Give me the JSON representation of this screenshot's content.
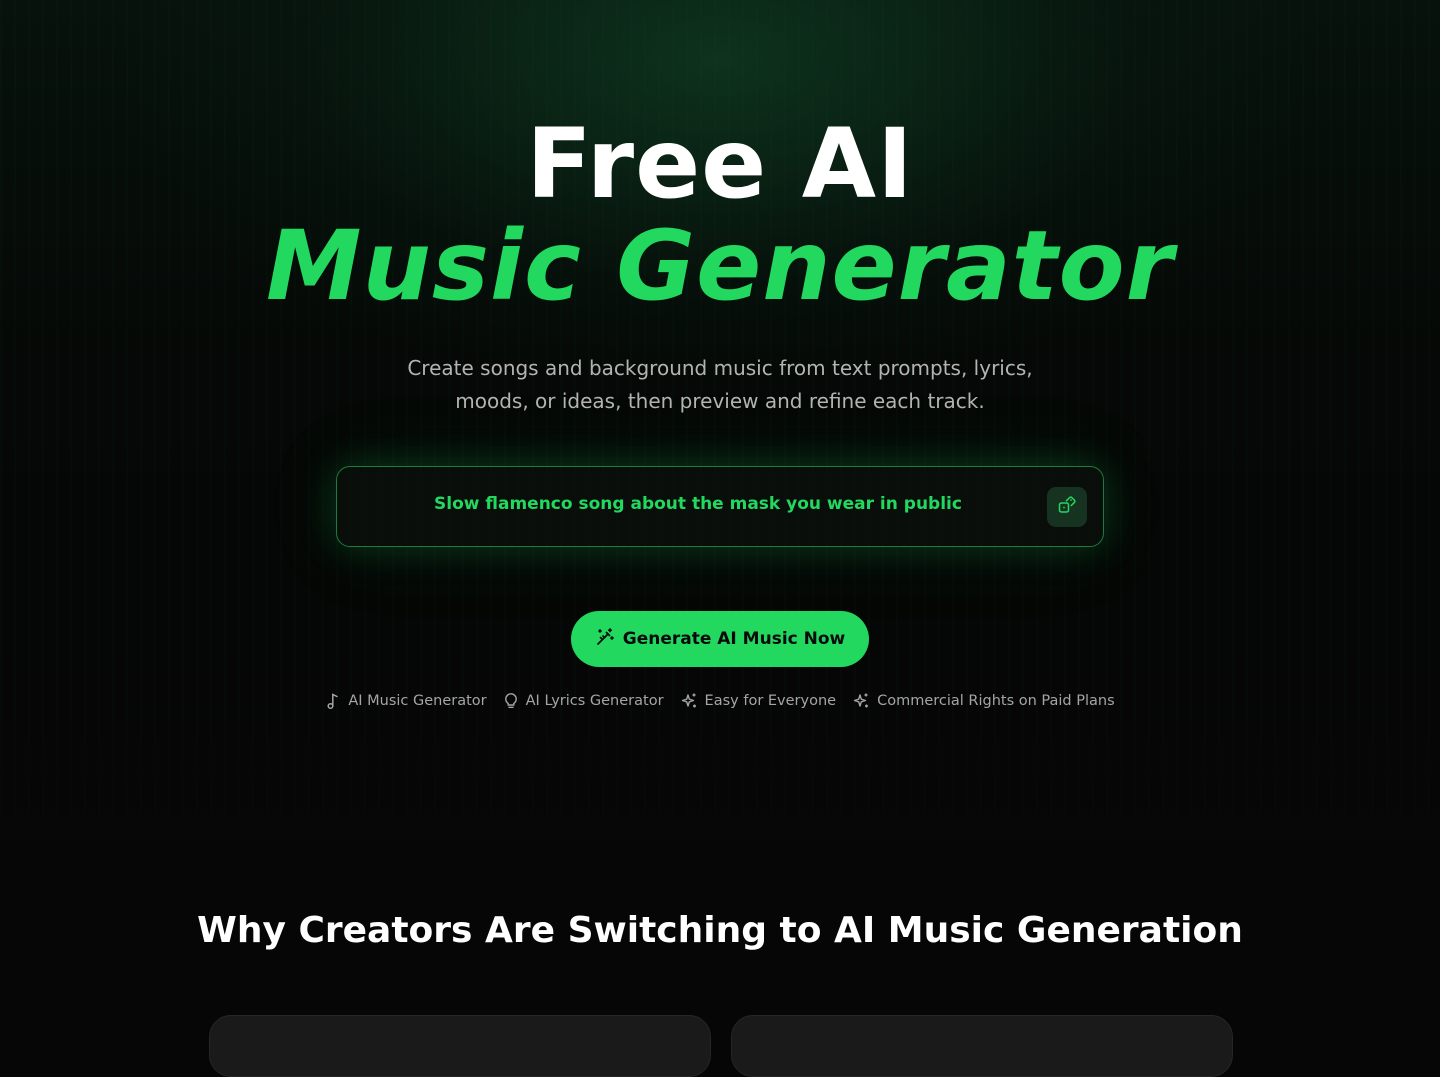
{
  "hero": {
    "title_line1": "Free AI",
    "title_line2": "Music Generator",
    "subtitle": "Create songs and background music from text prompts, lyrics, moods, or ideas, then preview and refine each track."
  },
  "prompt": {
    "text": "Slow flamenco song about the mask you wear in public",
    "random_button_icon": "dice-icon"
  },
  "cta": {
    "label": "Generate AI Music Now",
    "icon": "magic-wand-icon"
  },
  "features": [
    {
      "label": "AI Music Generator",
      "icon": "music-note-icon"
    },
    {
      "label": "AI Lyrics Generator",
      "icon": "lightbulb-icon"
    },
    {
      "label": "Easy for Everyone",
      "icon": "sparkles-icon"
    },
    {
      "label": "Commercial Rights on Paid Plans",
      "icon": "sparkles-icon"
    }
  ],
  "why_section": {
    "title": "Why Creators Are Switching to AI Music Generation"
  },
  "colors": {
    "accent": "#22d85e",
    "background": "#060606",
    "muted_text": "#a5a5a5"
  }
}
